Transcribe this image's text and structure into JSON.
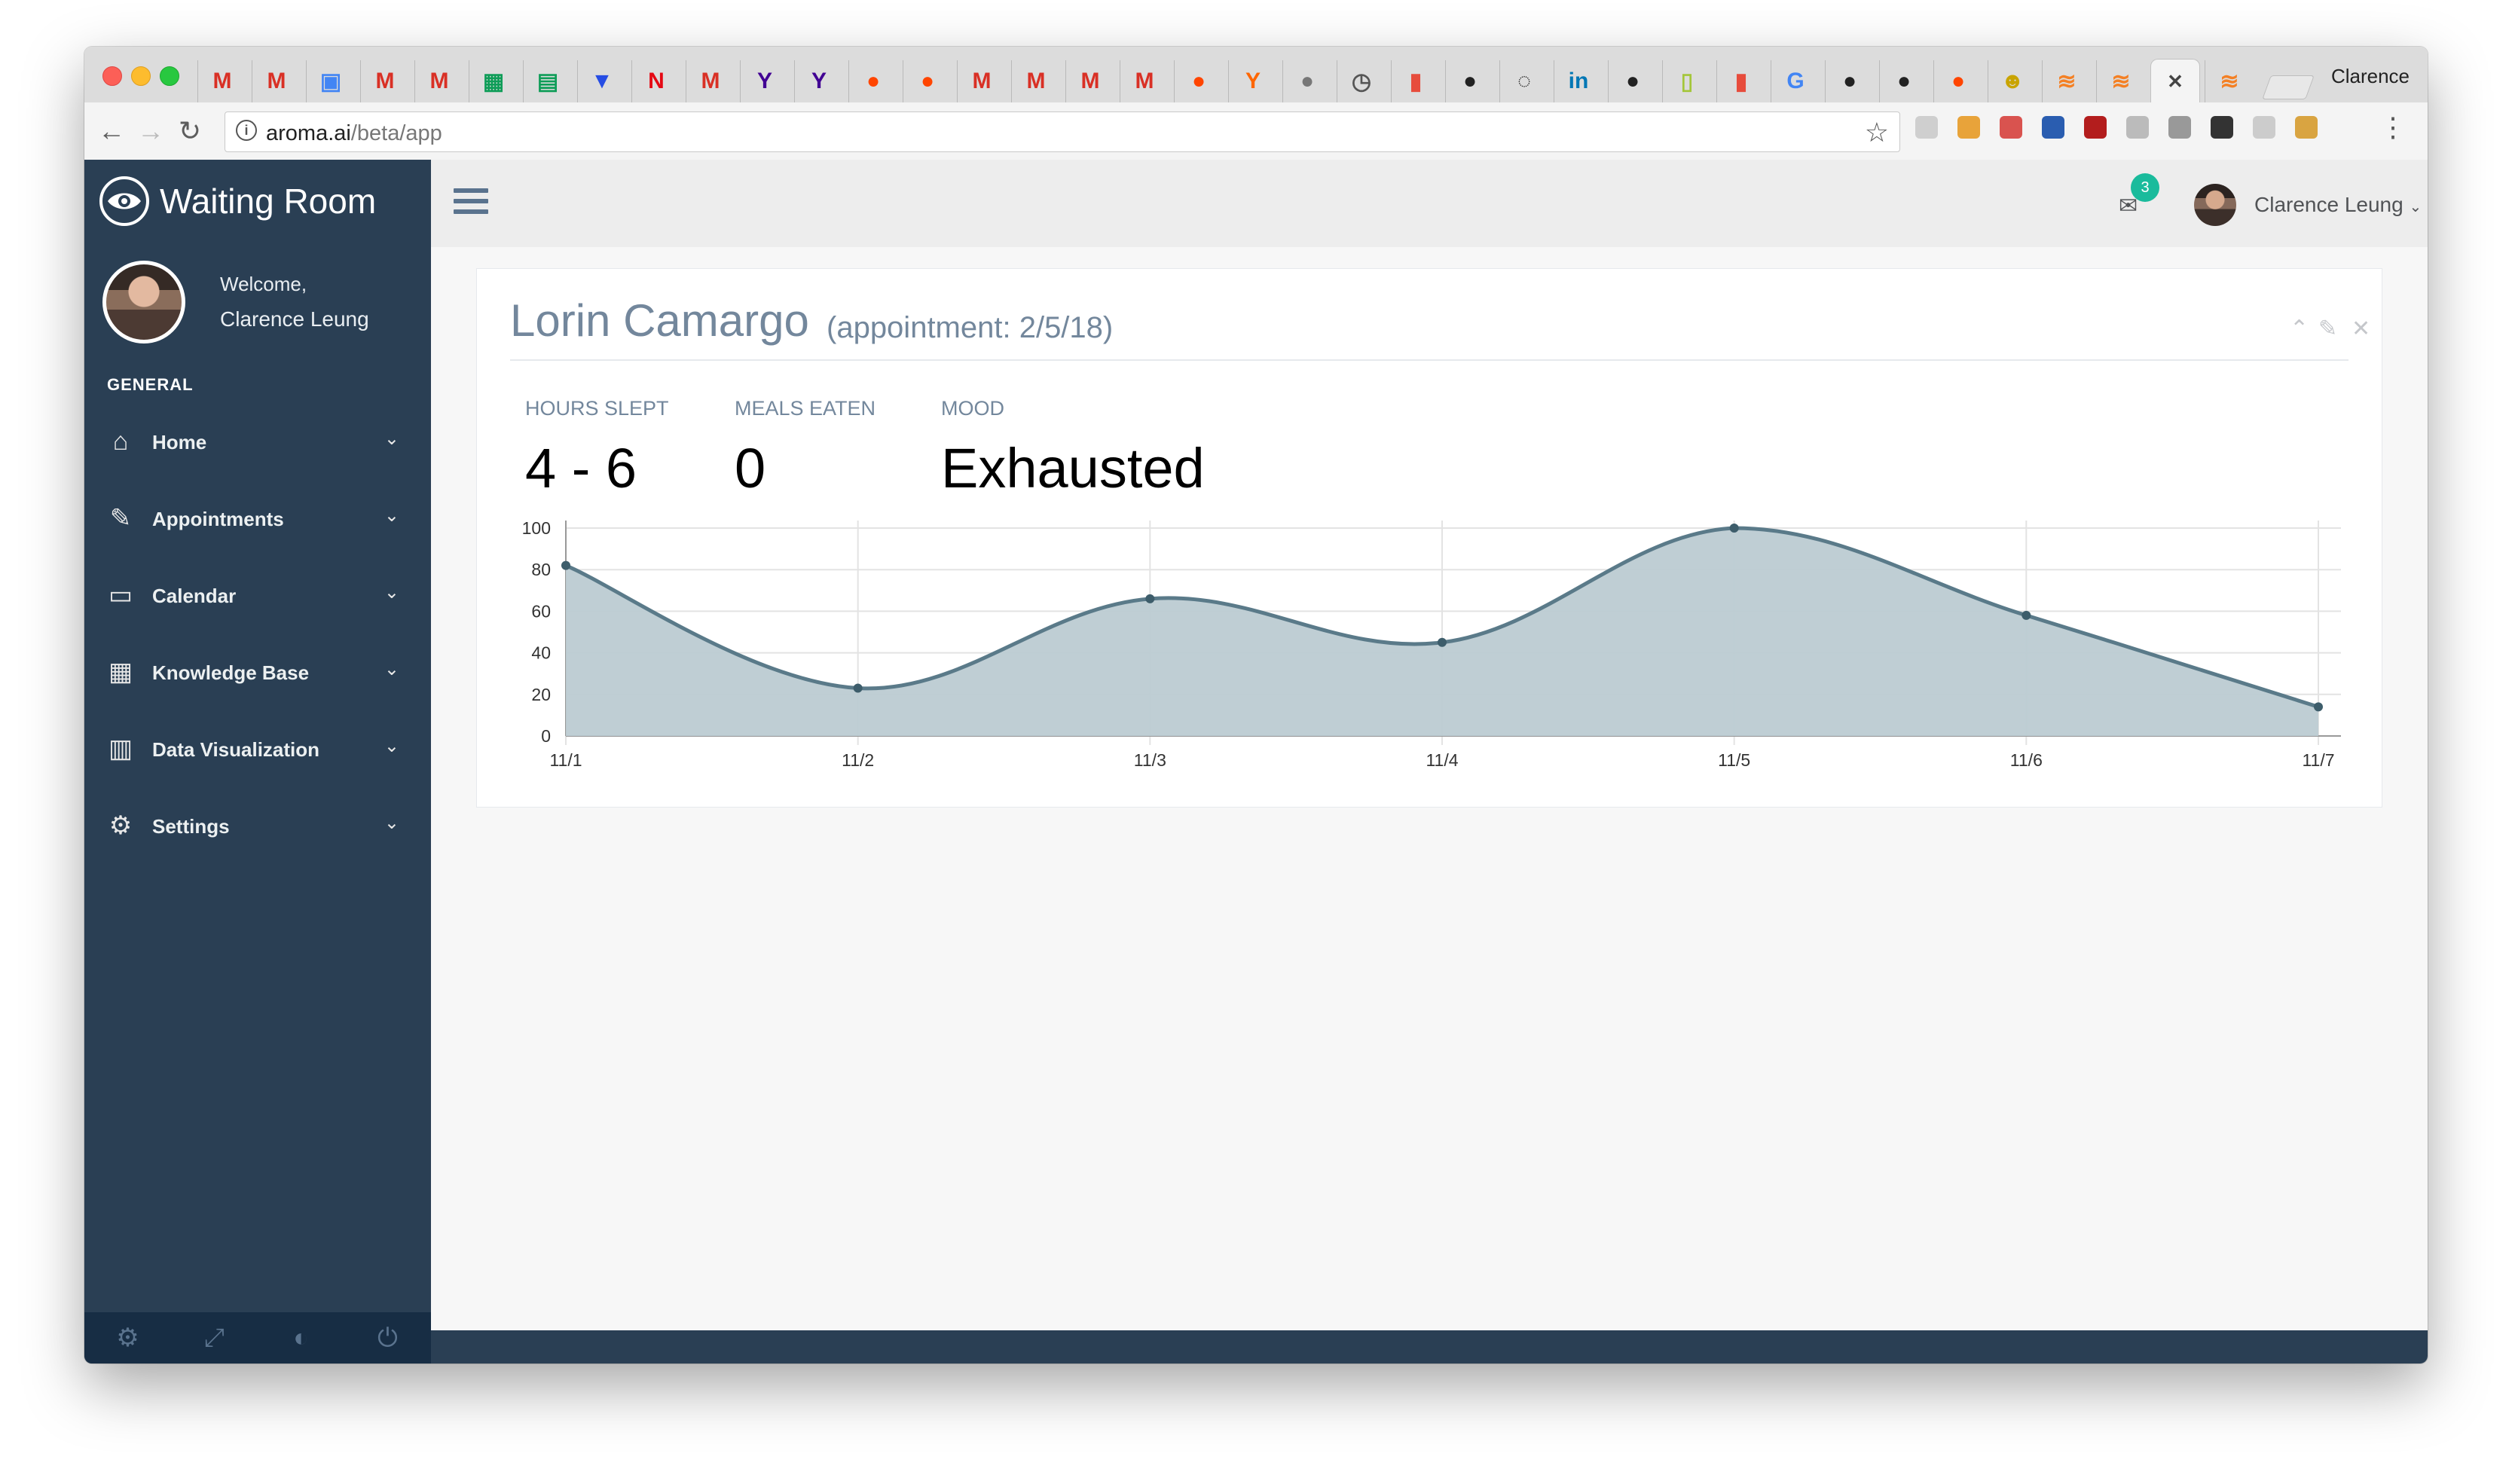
{
  "browser": {
    "profile_name": "Clarence",
    "url_host": "aroma.ai",
    "url_path": "/beta/app",
    "active_tab_glyph": "✕",
    "tabs": [
      {
        "icon": "gmail-icon",
        "glyph": "M",
        "color": "#d93025"
      },
      {
        "icon": "gmail-icon",
        "glyph": "M",
        "color": "#d93025"
      },
      {
        "icon": "contacts-icon",
        "glyph": "▣",
        "color": "#4285f4"
      },
      {
        "icon": "gmail-icon",
        "glyph": "M",
        "color": "#d93025"
      },
      {
        "icon": "gmail-icon",
        "glyph": "M",
        "color": "#d93025"
      },
      {
        "icon": "sheets-icon",
        "glyph": "▦",
        "color": "#0f9d58"
      },
      {
        "icon": "forms-icon",
        "glyph": "▤",
        "color": "#0f9d58"
      },
      {
        "icon": "css-icon",
        "glyph": "▼",
        "color": "#264de4"
      },
      {
        "icon": "netflix-icon",
        "glyph": "N",
        "color": "#e50914"
      },
      {
        "icon": "gmail-icon",
        "glyph": "M",
        "color": "#d93025"
      },
      {
        "icon": "yahoo-icon",
        "glyph": "Y",
        "color": "#410093"
      },
      {
        "icon": "yahoo-icon",
        "glyph": "Y",
        "color": "#410093"
      },
      {
        "icon": "reddit-icon",
        "glyph": "●",
        "color": "#ff4500"
      },
      {
        "icon": "reddit-icon",
        "glyph": "●",
        "color": "#ff4500"
      },
      {
        "icon": "gmail-icon",
        "glyph": "M",
        "color": "#d93025"
      },
      {
        "icon": "gmail-icon",
        "glyph": "M",
        "color": "#d93025"
      },
      {
        "icon": "gmail-icon",
        "glyph": "M",
        "color": "#d93025"
      },
      {
        "icon": "gmail-icon",
        "glyph": "M",
        "color": "#d93025"
      },
      {
        "icon": "reddit-icon",
        "glyph": "●",
        "color": "#ff4500"
      },
      {
        "icon": "hackernews-icon",
        "glyph": "Y",
        "color": "#ff6600"
      },
      {
        "icon": "apple-icon",
        "glyph": "●",
        "color": "#777777"
      },
      {
        "icon": "history-icon",
        "glyph": "◷",
        "color": "#555555"
      },
      {
        "icon": "office-icon",
        "glyph": "▮",
        "color": "#e74c3c"
      },
      {
        "icon": "github-icon",
        "glyph": "●",
        "color": "#222222"
      },
      {
        "icon": "loading-icon",
        "glyph": "◌",
        "color": "#222222"
      },
      {
        "icon": "linkedin-icon",
        "glyph": "in",
        "color": "#0077b5"
      },
      {
        "icon": "github-icon",
        "glyph": "●",
        "color": "#222222"
      },
      {
        "icon": "android-icon",
        "glyph": "▯",
        "color": "#a4c639"
      },
      {
        "icon": "office-icon",
        "glyph": "▮",
        "color": "#e74c3c"
      },
      {
        "icon": "google-icon",
        "glyph": "G",
        "color": "#4285f4"
      },
      {
        "icon": "github-icon",
        "glyph": "●",
        "color": "#222222"
      },
      {
        "icon": "github-icon",
        "glyph": "●",
        "color": "#222222"
      },
      {
        "icon": "reddit-icon",
        "glyph": "●",
        "color": "#ff4500"
      },
      {
        "icon": "character-icon",
        "glyph": "☻",
        "color": "#c9a400"
      },
      {
        "icon": "stackoverflow-icon",
        "glyph": "≋",
        "color": "#f48024"
      },
      {
        "icon": "stackoverflow-icon",
        "glyph": "≋",
        "color": "#f48024"
      }
    ],
    "trailing_tab_icon": {
      "icon": "stackoverflow-icon",
      "glyph": "≋",
      "color": "#f48024"
    },
    "extension_colors": [
      "#cfcfcf",
      "#e8a33a",
      "#d9534f",
      "#2a5db0",
      "#b31d1d",
      "#bbbbbb",
      "#999999",
      "#333333",
      "#cccccc",
      "#d9a441"
    ]
  },
  "app": {
    "brand_title": "Waiting Room",
    "welcome": "Welcome,",
    "user_name": "Clarence Leung",
    "section_title": "GENERAL",
    "menu": [
      {
        "label": "Home",
        "icon": "home-icon",
        "glyph": "⌂"
      },
      {
        "label": "Appointments",
        "icon": "edit-icon",
        "glyph": "✎"
      },
      {
        "label": "Calendar",
        "icon": "desktop-icon",
        "glyph": "▭"
      },
      {
        "label": "Knowledge Base",
        "icon": "table-icon",
        "glyph": "▦"
      },
      {
        "label": "Data Visualization",
        "icon": "bar-chart-icon",
        "glyph": "▥"
      },
      {
        "label": "Settings",
        "icon": "gear-icon",
        "glyph": "⚙"
      }
    ],
    "mail_badge": "3",
    "topnav_user": "Clarence Leung"
  },
  "panel": {
    "patient_name": "Lorin Camargo",
    "appointment": "(appointment: 2/5/18)",
    "stats": [
      {
        "label": "HOURS SLEPT",
        "value": "4 - 6"
      },
      {
        "label": "MEALS EATEN",
        "value": "0"
      },
      {
        "label": "MOOD",
        "value": "Exhausted"
      }
    ]
  },
  "chart_data": {
    "type": "area",
    "categories": [
      "11/1",
      "11/2",
      "11/3",
      "11/4",
      "11/5",
      "11/6",
      "11/7"
    ],
    "series": [
      {
        "values": [
          82,
          23,
          66,
          45,
          100,
          58,
          14
        ]
      }
    ],
    "ylim": [
      0,
      100
    ],
    "yticks": [
      0,
      20,
      40,
      60,
      80,
      100
    ],
    "grid": true,
    "fill_color": "#bccbd2",
    "line_color": "#5a7a89"
  }
}
